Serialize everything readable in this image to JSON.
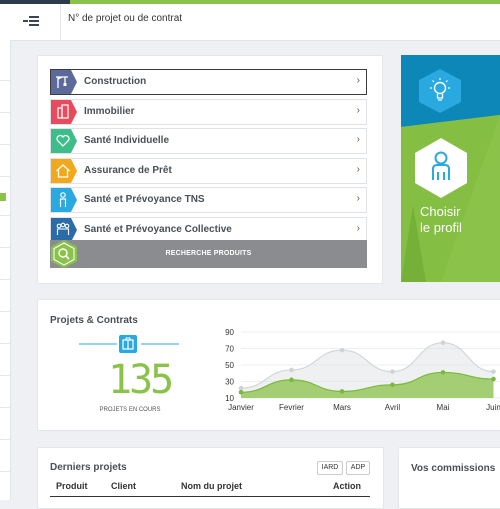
{
  "search": {
    "placeholder": "N° de projet ou de contrat"
  },
  "products": [
    {
      "label": "Construction",
      "color": "#5b6a9a",
      "icon": "crane-icon"
    },
    {
      "label": "Immobilier",
      "color": "#e74c5e",
      "icon": "building-icon"
    },
    {
      "label": "Santé Individuelle",
      "color": "#3dbd8a",
      "icon": "heart-icon"
    },
    {
      "label": "Assurance de Prêt",
      "color": "#f1a91b",
      "icon": "house-icon"
    },
    {
      "label": "Santé et Prévoyance TNS",
      "color": "#2aa8e0",
      "icon": "person-icon"
    },
    {
      "label": "Santé et Prévoyance Collective",
      "color": "#2b6ca8",
      "icon": "group-icon"
    }
  ],
  "search_products_label": "RECHERCHE PRODUITS",
  "profile": {
    "line1": "Choisir",
    "line2": "le profil"
  },
  "projects": {
    "title": "Projets & Contrats",
    "count": "135",
    "count_label": "PROJETS EN COURS"
  },
  "chart_data": {
    "type": "area",
    "categories": [
      "Janvier",
      "Fevrier",
      "Mars",
      "Avril",
      "Mai",
      "Juin"
    ],
    "yticks": [
      10,
      30,
      50,
      70,
      90
    ],
    "ylim": [
      10,
      90
    ],
    "series": [
      {
        "values": [
          22,
          44,
          68,
          42,
          77,
          42
        ],
        "color": "#e0e3e5"
      },
      {
        "values": [
          17,
          32,
          18,
          26,
          41,
          33
        ],
        "color": "#8bc34a"
      }
    ]
  },
  "recent": {
    "title": "Derniers projets",
    "badge_iard": "IARD",
    "badge_adp": "ADP",
    "columns": [
      "Produit",
      "Client",
      "Nom du projet",
      "Action"
    ]
  },
  "commissions": {
    "title": "Vos commissions"
  }
}
